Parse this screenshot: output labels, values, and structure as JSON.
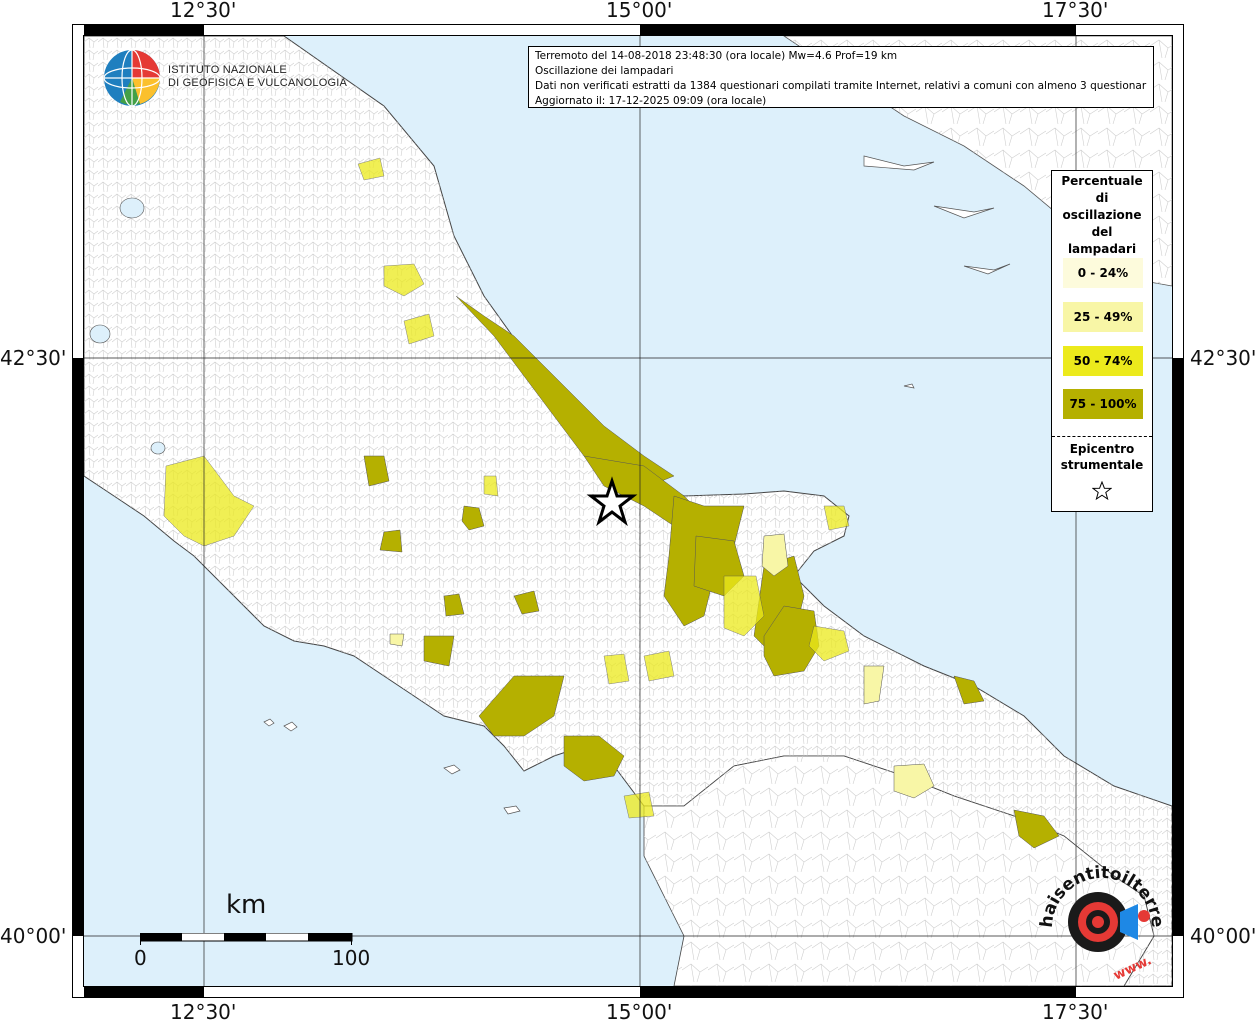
{
  "map": {
    "title": "Terremoto del 14-08-2018 23:48:30 (ora locale) Mw=4.6 Prof=19 km",
    "subtitle": "Oscillazione dei lampadari",
    "note": "Dati non verificati estratti da 1384 questionari compilati tramite Internet, relativi a comuni con almeno 3 questionari.",
    "updated": "Aggiornato il: 17-12-2025 09:09 (ora locale)",
    "longitude_labels": [
      "12°30'",
      "15°00'",
      "17°30'"
    ],
    "latitude_labels": [
      "42°30'",
      "40°00'"
    ],
    "colors": {
      "sea": "#ddf0fb",
      "land": "#ffffff",
      "class_0_24": "#fdfbdc",
      "class_25_49": "#f8f6a6",
      "class_50_74": "#ecea1c",
      "class_75_100": "#b5b000"
    }
  },
  "institute": {
    "line1": "ISTITUTO NAZIONALE",
    "line2": "DI GEOFISICA E VULCANOLOGIA"
  },
  "legend": {
    "title": [
      "Percentuale",
      "di",
      "oscillazione",
      "del",
      "lampadari"
    ],
    "items": [
      {
        "label": "0 - 24%",
        "color": "#fdfbdc"
      },
      {
        "label": "25 - 49%",
        "color": "#f8f6a6"
      },
      {
        "label": "50 - 74%",
        "color": "#ecea1c"
      },
      {
        "label": "75 - 100%",
        "color": "#b5b000"
      }
    ],
    "epicenter_title": [
      "Epicentro",
      "strumentale"
    ],
    "epicenter_icon": "star-icon"
  },
  "scale_bar": {
    "unit": "km",
    "start": "0",
    "end": "100"
  },
  "watermark": {
    "text": "haisentitoilterremoto.it",
    "url_text": "www.",
    "icon": "seismic-speaker-icon"
  }
}
